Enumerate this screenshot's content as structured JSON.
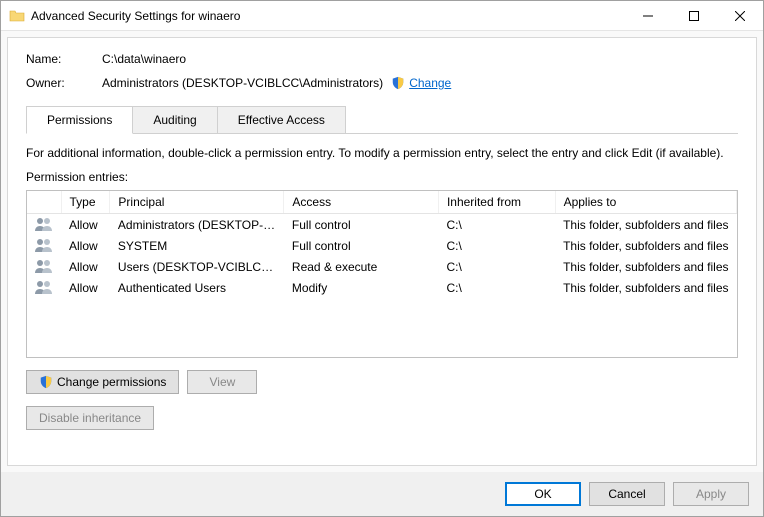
{
  "title": "Advanced Security Settings for winaero",
  "name_label": "Name:",
  "name_value": "C:\\data\\winaero",
  "owner_label": "Owner:",
  "owner_value": "Administrators (DESKTOP-VCIBLCC\\Administrators)",
  "change_label": "Change",
  "tabs": {
    "permissions": "Permissions",
    "auditing": "Auditing",
    "effective": "Effective Access"
  },
  "info_text": "For additional information, double-click a permission entry. To modify a permission entry, select the entry and click Edit (if available).",
  "entries_label": "Permission entries:",
  "columns": {
    "type": "Type",
    "principal": "Principal",
    "access": "Access",
    "inherited": "Inherited from",
    "applies": "Applies to"
  },
  "entries": [
    {
      "type": "Allow",
      "principal": "Administrators (DESKTOP-VCI...",
      "access": "Full control",
      "inherited": "C:\\",
      "applies": "This folder, subfolders and files"
    },
    {
      "type": "Allow",
      "principal": "SYSTEM",
      "access": "Full control",
      "inherited": "C:\\",
      "applies": "This folder, subfolders and files"
    },
    {
      "type": "Allow",
      "principal": "Users (DESKTOP-VCIBLCC\\Us...",
      "access": "Read & execute",
      "inherited": "C:\\",
      "applies": "This folder, subfolders and files"
    },
    {
      "type": "Allow",
      "principal": "Authenticated Users",
      "access": "Modify",
      "inherited": "C:\\",
      "applies": "This folder, subfolders and files"
    }
  ],
  "buttons": {
    "change_perms": "Change permissions",
    "view": "View",
    "disable_inherit": "Disable inheritance",
    "ok": "OK",
    "cancel": "Cancel",
    "apply": "Apply"
  }
}
